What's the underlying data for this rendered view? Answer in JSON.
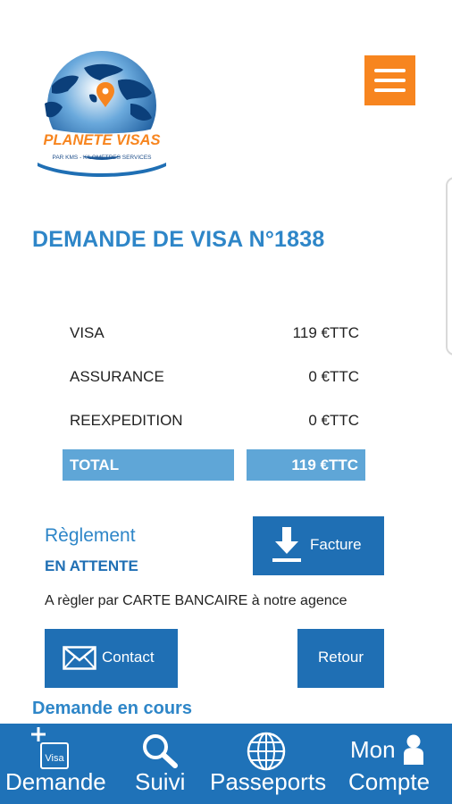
{
  "logo": {
    "brand": "PLANETE VISAS",
    "tagline": "PAR KMS - KILOMETRES SERVICES",
    "colors": {
      "blue": "#1f6fb4",
      "orange": "#f7851f"
    }
  },
  "menu_button": {
    "icon": "hamburger-icon",
    "color": "#f7851f"
  },
  "page_title": "DEMANDE DE VISA N°1838",
  "fees": [
    {
      "label": "VISA",
      "amount": "119 €TTC"
    },
    {
      "label": "ASSURANCE",
      "amount": "0 €TTC"
    },
    {
      "label": "REEXPEDITION",
      "amount": "0 €TTC"
    }
  ],
  "total": {
    "label": "TOTAL",
    "amount": "119 €TTC"
  },
  "payment": {
    "label": "Règlement",
    "status": "EN ATTENTE",
    "instructions": "A règler par CARTE BANCAIRE à notre agence"
  },
  "buttons": {
    "facture": {
      "label": "Facture",
      "icon": "download-icon"
    },
    "contact": {
      "label": "Contact",
      "icon": "envelope-icon"
    },
    "retour": {
      "label": "Retour"
    }
  },
  "section_heading": "Demande en cours",
  "bottom_nav": [
    {
      "label": "Demande",
      "icon": "visa-add-icon",
      "icon_text": "Visa"
    },
    {
      "label": "Suivi",
      "icon": "search-icon"
    },
    {
      "label": "Passeports",
      "icon": "globe-icon"
    },
    {
      "label_top": "Mon",
      "label": "Compte",
      "icon": "user-icon"
    }
  ]
}
